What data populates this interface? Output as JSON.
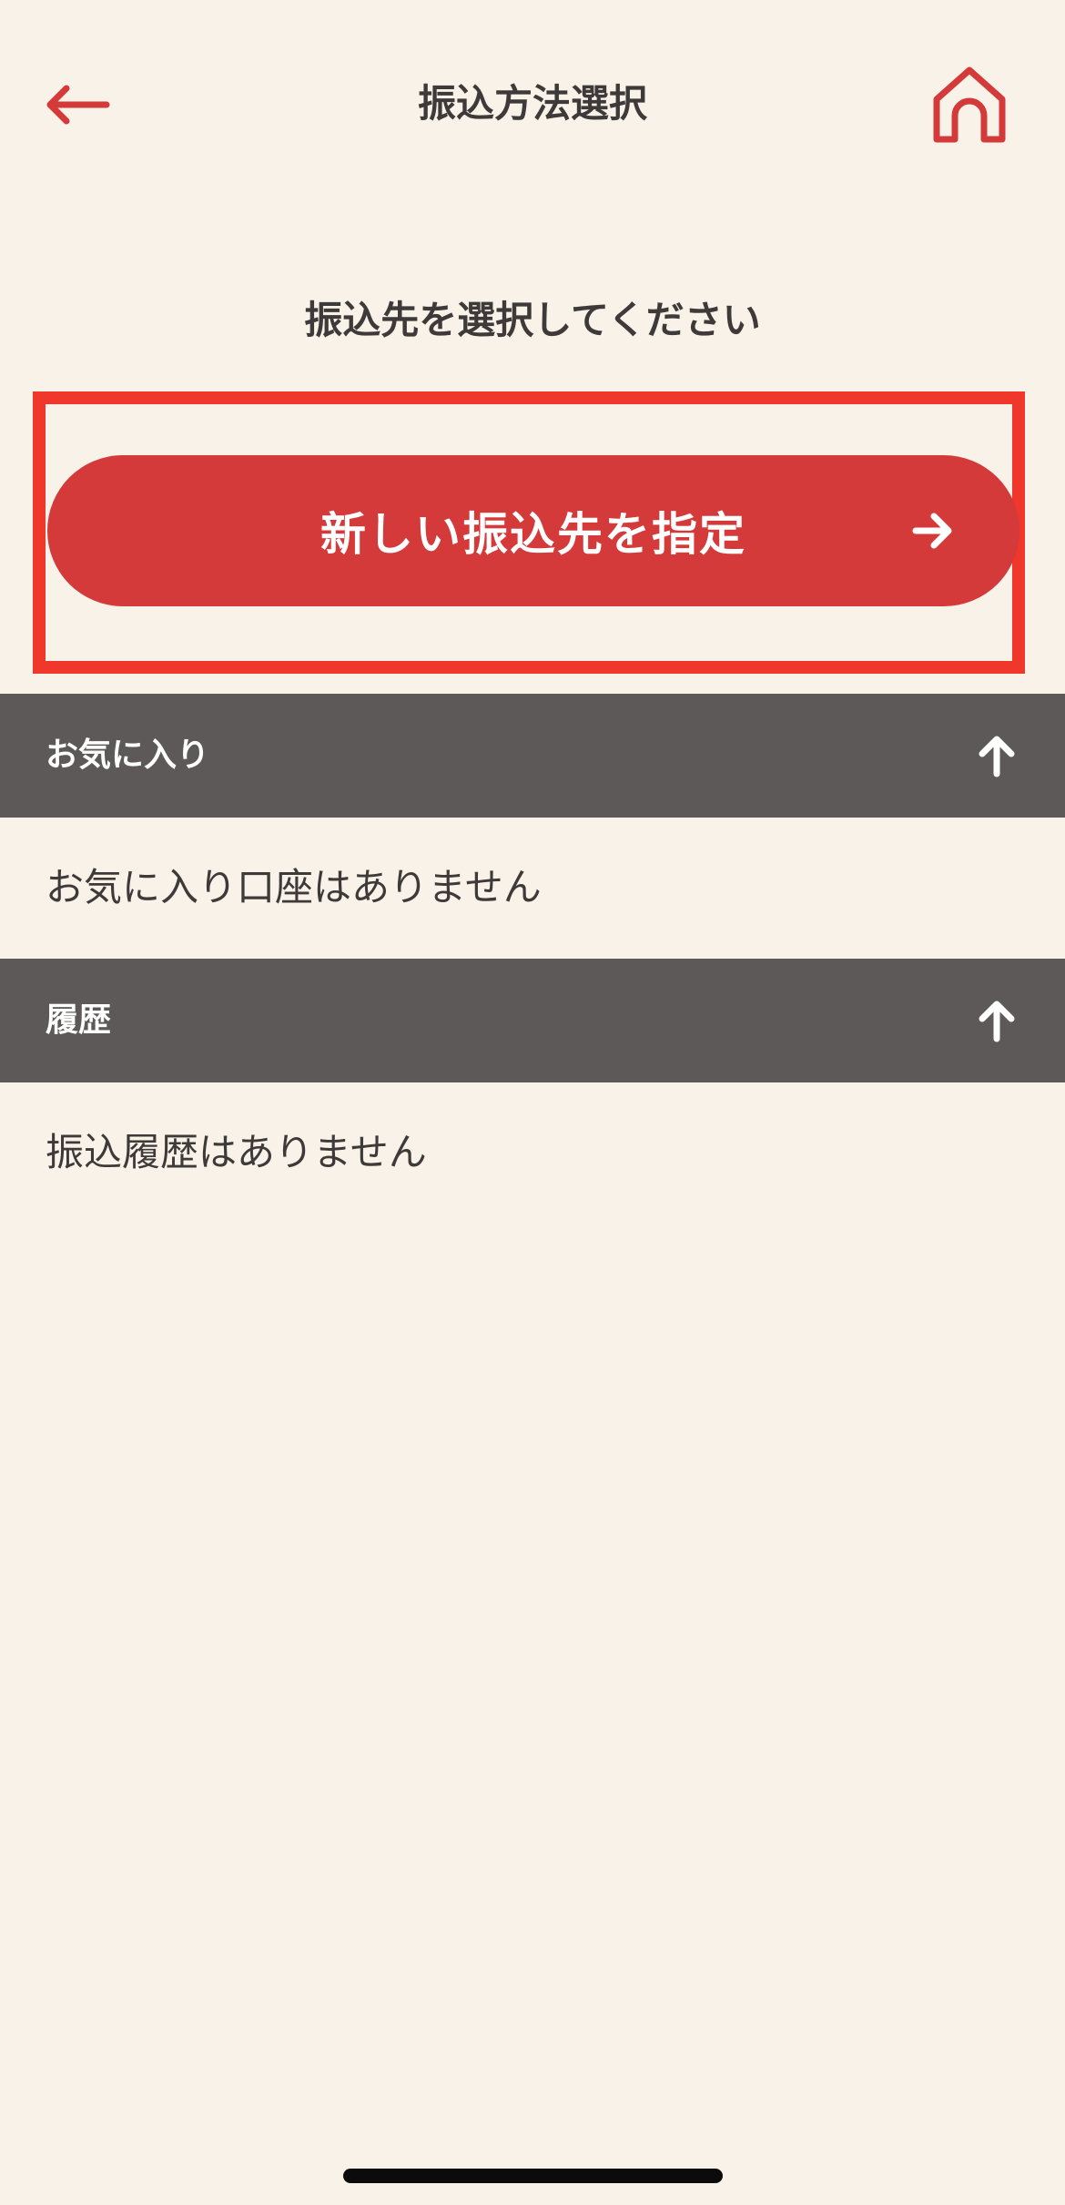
{
  "header": {
    "title": "振込方法選択",
    "back_icon": "back-arrow-icon",
    "home_icon": "home-icon"
  },
  "instruction": "振込先を選択してください",
  "new_destination": {
    "label": "新しい振込先を指定",
    "icon": "arrow-right-icon"
  },
  "sections": {
    "favorites": {
      "title": "お気に入り",
      "toggle_icon": "arrow-up-icon",
      "empty_message": "お気に入り口座はありません"
    },
    "history": {
      "title": "履歴",
      "toggle_icon": "arrow-up-icon",
      "empty_message": "振込履歴はありません"
    }
  },
  "colors": {
    "background": "#f8f2e8",
    "accent_red": "#d53a3a",
    "highlight_red": "#f0372b",
    "section_header_bg": "#5d5958",
    "text": "#3d3a39"
  }
}
